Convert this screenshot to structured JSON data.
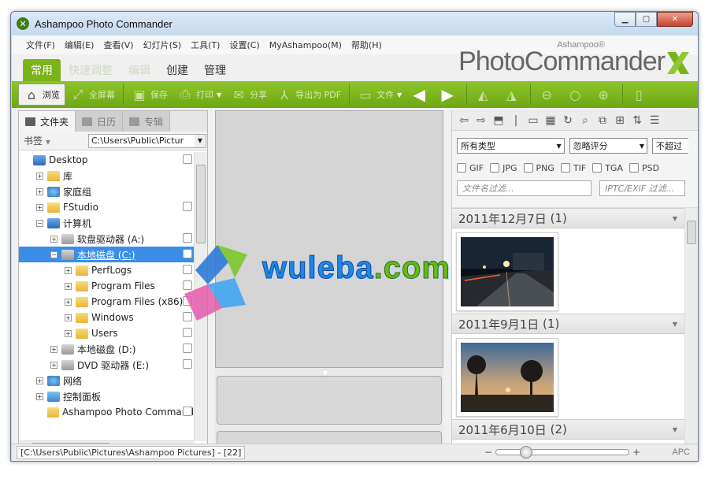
{
  "window": {
    "title": "Ashampoo Photo Commander"
  },
  "menu": [
    "文件(F)",
    "编辑(E)",
    "查看(V)",
    "幻灯片(S)",
    "工具(T)",
    "设置(C)",
    "MyAshampoo(M)",
    "帮助(H)"
  ],
  "brand": {
    "small": "Ashampoo®",
    "big": "PhotoCommander"
  },
  "ribbon_tabs": [
    {
      "label": "常用",
      "state": "active"
    },
    {
      "label": "快速调整",
      "state": "disabled"
    },
    {
      "label": "编辑",
      "state": "disabled"
    },
    {
      "label": "创建",
      "state": "normal"
    },
    {
      "label": "管理",
      "state": "normal"
    }
  ],
  "toolbar": {
    "browse": "浏览",
    "fullscreen": "全屏幕",
    "save": "保存",
    "print": "打印",
    "share": "分享",
    "export_pdf": "导出为 PDF",
    "file": "文件"
  },
  "left": {
    "tabs": [
      "文件夹",
      "日历",
      "专辑"
    ],
    "bookmark_label": "书签",
    "path": "C:\\Users\\Public\\Pictur",
    "tree": [
      {
        "label": "Desktop",
        "level": 0,
        "exp": "",
        "icon": "desktop-icon",
        "chk": true
      },
      {
        "label": "库",
        "level": 1,
        "exp": "+",
        "icon": "library-icon",
        "chk": false
      },
      {
        "label": "家庭组",
        "level": 1,
        "exp": "+",
        "icon": "homegroup-icon",
        "chk": false
      },
      {
        "label": "FStudio",
        "level": 1,
        "exp": "+",
        "icon": "user-folder-icon",
        "chk": true
      },
      {
        "label": "计算机",
        "level": 1,
        "exp": "−",
        "icon": "computer-icon",
        "chk": false
      },
      {
        "label": "软盘驱动器 (A:)",
        "level": 2,
        "exp": "+",
        "icon": "floppy-icon",
        "chk": true
      },
      {
        "label": "本地磁盘 (C:)",
        "level": 2,
        "exp": "−",
        "icon": "drive-icon",
        "chk": true,
        "selected": true
      },
      {
        "label": "PerfLogs",
        "level": 3,
        "exp": "+",
        "icon": "folder-icon",
        "chk": true
      },
      {
        "label": "Program Files",
        "level": 3,
        "exp": "+",
        "icon": "folder-icon",
        "chk": true
      },
      {
        "label": "Program Files (x86)",
        "level": 3,
        "exp": "+",
        "icon": "folder-icon",
        "chk": true
      },
      {
        "label": "Windows",
        "level": 3,
        "exp": "+",
        "icon": "folder-icon",
        "chk": true
      },
      {
        "label": "Users",
        "level": 3,
        "exp": "+",
        "icon": "folder-icon",
        "chk": true
      },
      {
        "label": "本地磁盘 (D:)",
        "level": 2,
        "exp": "+",
        "icon": "drive-icon",
        "chk": true
      },
      {
        "label": "DVD 驱动器 (E:)",
        "level": 2,
        "exp": "+",
        "icon": "dvd-icon",
        "chk": true
      },
      {
        "label": "网络",
        "level": 1,
        "exp": "+",
        "icon": "network-icon",
        "chk": false
      },
      {
        "label": "控制面板",
        "level": 1,
        "exp": "+",
        "icon": "control-panel-icon",
        "chk": false
      },
      {
        "label": "Ashampoo Photo Command",
        "level": 1,
        "exp": "",
        "icon": "folder-icon",
        "chk": true
      }
    ]
  },
  "right": {
    "type_select": "所有类型",
    "rating_select": "忽略评分",
    "third_select": "不超过",
    "formats": [
      "GIF",
      "JPG",
      "PNG",
      "TIF",
      "TGA",
      "PSD"
    ],
    "filename_filter": "文件名过滤...",
    "iptc_filter": "IPTC/EXIF 过滤...",
    "groups": [
      {
        "date": "2011年12月7日",
        "count": "(1)"
      },
      {
        "date": "2011年9月1日",
        "count": "(1)"
      },
      {
        "date": "2011年6月10日",
        "count": "(2)"
      }
    ]
  },
  "status": {
    "path": "[C:\\Users\\Public\\Pictures\\Ashampoo Pictures] - [22]",
    "minus": "−",
    "plus": "+",
    "apc": "APC"
  },
  "watermark": {
    "main": "wuleba",
    "dot": ".",
    "com": "com"
  },
  "colors": {
    "accent_green": "#79b418",
    "selection_blue": "#3a8ee6"
  }
}
